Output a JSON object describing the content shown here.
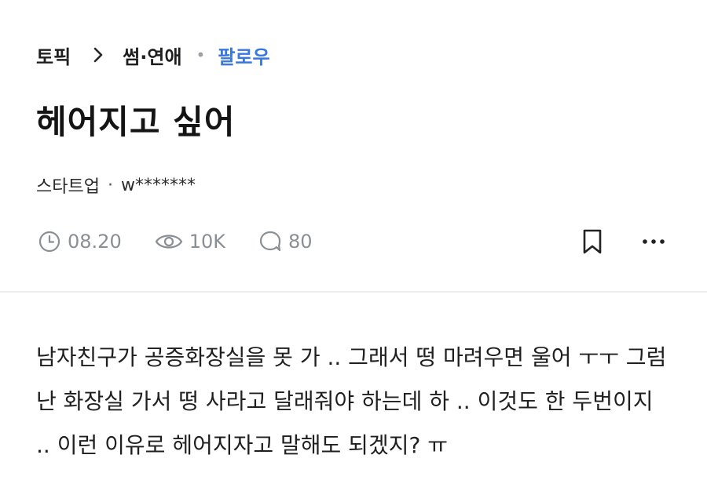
{
  "breadcrumb": {
    "topic": "토픽",
    "category": "썸·연애",
    "follow_label": "팔로우"
  },
  "post": {
    "title": "헤어지고 싶어",
    "author_company": "스타트업",
    "author_separator": "·",
    "author_name": "w*******",
    "date": "08.20",
    "views": "10K",
    "comments": "80",
    "body": "남자친구가 공증화장실을 못 가 .. 그래서 떵 마려우면 울어 ㅜㅜ 그럼 난 화장실 가서 떵 사라고 달래줘야 하는데 하 .. 이것도 한 두번이지 .. 이런 이유로 헤어지자고 말해도 되겠지? ㅠ"
  },
  "icons": {
    "breadcrumb_separator": "chevron-right-icon",
    "date": "clock-icon",
    "views": "eye-icon",
    "comments": "comment-bubble-icon",
    "bookmark": "bookmark-icon",
    "more": "more-horizontal-icon"
  },
  "colors": {
    "accent": "#3877e0",
    "meta_gray": "#8a8f95",
    "divider": "#ededed"
  }
}
